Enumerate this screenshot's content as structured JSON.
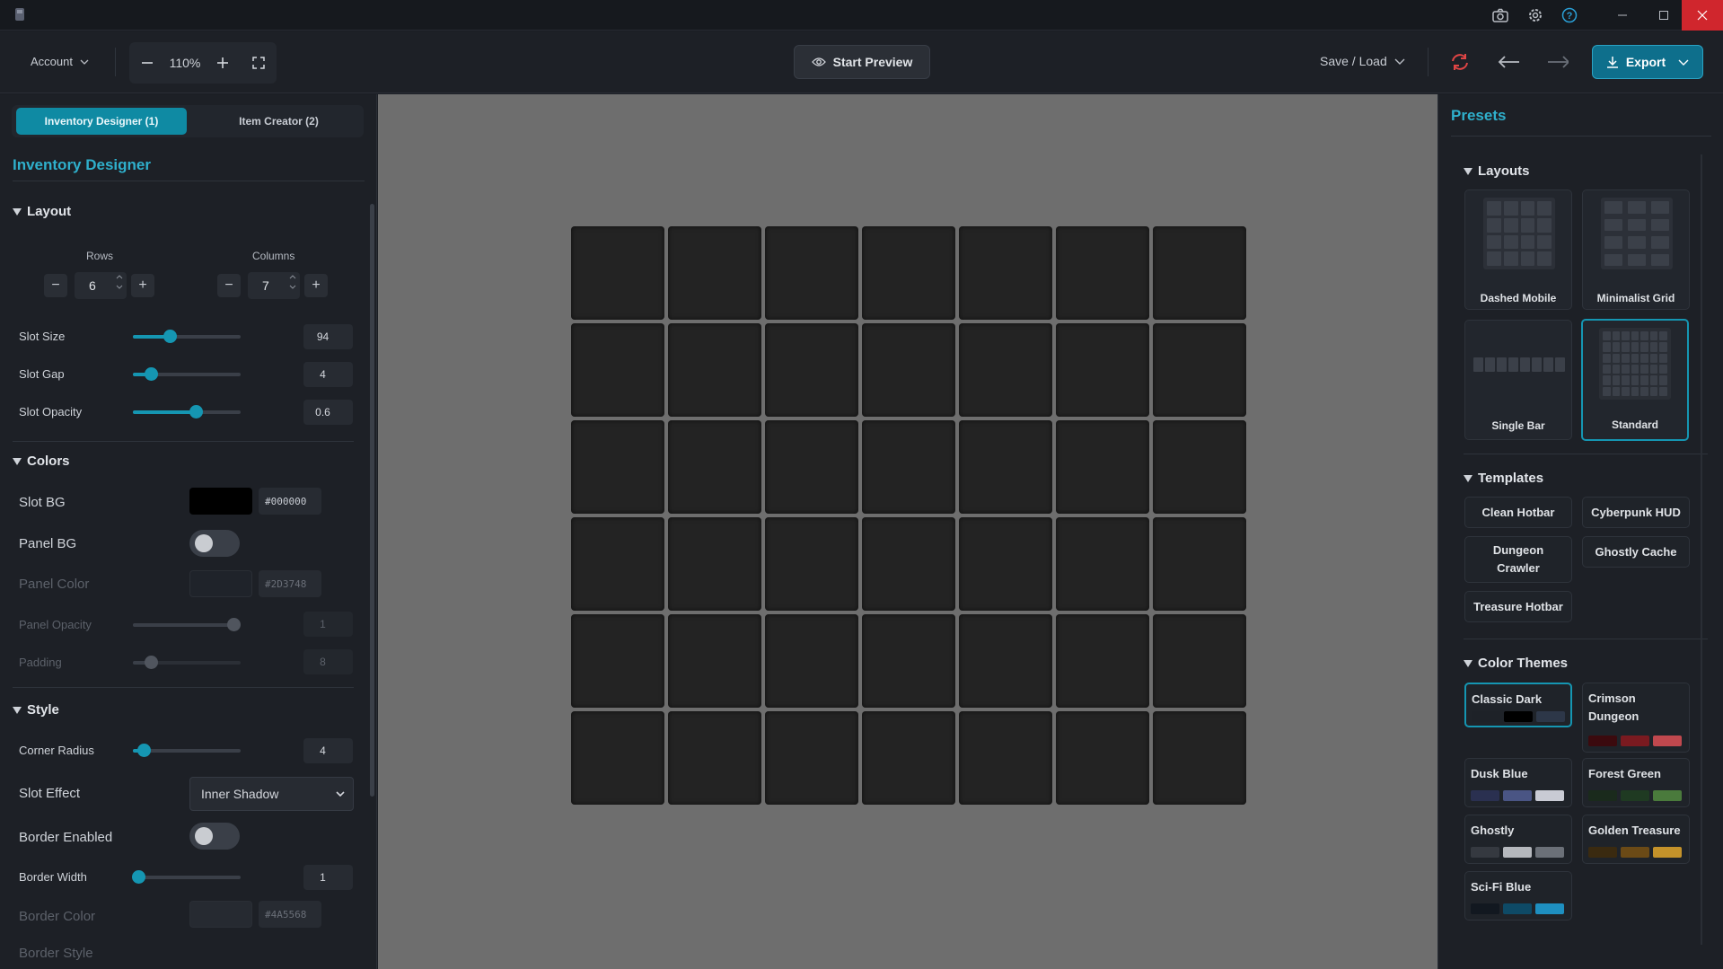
{
  "titlebar": {
    "icons": [
      "camera-icon",
      "gear-icon",
      "help-icon"
    ],
    "window_buttons": [
      "minimize-icon",
      "maximize-icon",
      "close-icon"
    ]
  },
  "toolbar": {
    "account_label": "Account",
    "zoom_value": "110%",
    "preview_label": "Start Preview",
    "saveload_label": "Save / Load",
    "export_label": "Export"
  },
  "sidebar": {
    "tabs": [
      {
        "label": "Inventory Designer (1)",
        "active": true
      },
      {
        "label": "Item Creator (2)",
        "active": false
      }
    ],
    "title": "Inventory Designer",
    "layout": {
      "heading": "Layout",
      "rows_label": "Rows",
      "rows_value": "6",
      "cols_label": "Columns",
      "cols_value": "7",
      "slot_size_label": "Slot Size",
      "slot_size_value": "94",
      "slot_gap_label": "Slot Gap",
      "slot_gap_value": "4",
      "slot_opacity_label": "Slot Opacity",
      "slot_opacity_value": "0.6"
    },
    "colors": {
      "heading": "Colors",
      "slot_bg_label": "Slot BG",
      "slot_bg_hex": "#000000",
      "panel_bg_label": "Panel BG",
      "panel_color_label": "Panel Color",
      "panel_color_hex": "#2D3748",
      "panel_opacity_label": "Panel Opacity",
      "panel_opacity_value": "1",
      "padding_label": "Padding",
      "padding_value": "8"
    },
    "style": {
      "heading": "Style",
      "corner_radius_label": "Corner Radius",
      "corner_radius_value": "4",
      "slot_effect_label": "Slot Effect",
      "slot_effect_value": "Inner Shadow",
      "border_enabled_label": "Border Enabled",
      "border_width_label": "Border Width",
      "border_width_value": "1",
      "border_color_label": "Border Color",
      "border_color_hex": "#4A5568",
      "border_style_label": "Border Style"
    }
  },
  "canvas": {
    "rows": 6,
    "cols": 7,
    "slot_color": "#232323",
    "background": "#6e6e6e"
  },
  "presets": {
    "title": "Presets",
    "layouts_heading": "Layouts",
    "layouts": [
      {
        "name": "Dashed Mobile"
      },
      {
        "name": "Minimalist Grid"
      },
      {
        "name": "Single Bar"
      },
      {
        "name": "Standard",
        "selected": true
      }
    ],
    "templates_heading": "Templates",
    "templates": [
      "Clean Hotbar",
      "Cyberpunk HUD",
      "Dungeon Crawler",
      "Ghostly Cache",
      "Treasure Hotbar"
    ],
    "themes_heading": "Color Themes",
    "themes": [
      {
        "name": "Classic Dark",
        "selected": true,
        "colors": [
          "#1e2228",
          "#000000",
          "#2d3748"
        ]
      },
      {
        "name": "Crimson Dungeon",
        "colors": [
          "#3b0a0e",
          "#7a1a20",
          "#c0484e"
        ]
      },
      {
        "name": "Dusk Blue",
        "colors": [
          "#2a3050",
          "#4a5584",
          "#c9cbd4"
        ]
      },
      {
        "name": "Forest Green",
        "colors": [
          "#1a2a1c",
          "#1f3a22",
          "#4a7a3c"
        ]
      },
      {
        "name": "Ghostly",
        "colors": [
          "#353940",
          "#b5b8bd",
          "#6b7078"
        ]
      },
      {
        "name": "Golden Treasure",
        "colors": [
          "#3a2a10",
          "#6b4a16",
          "#c4922a"
        ]
      },
      {
        "name": "Sci-Fi Blue",
        "colors": [
          "#121820",
          "#0e4a66",
          "#1e8fc0"
        ]
      }
    ]
  },
  "accent": "#1596b2"
}
